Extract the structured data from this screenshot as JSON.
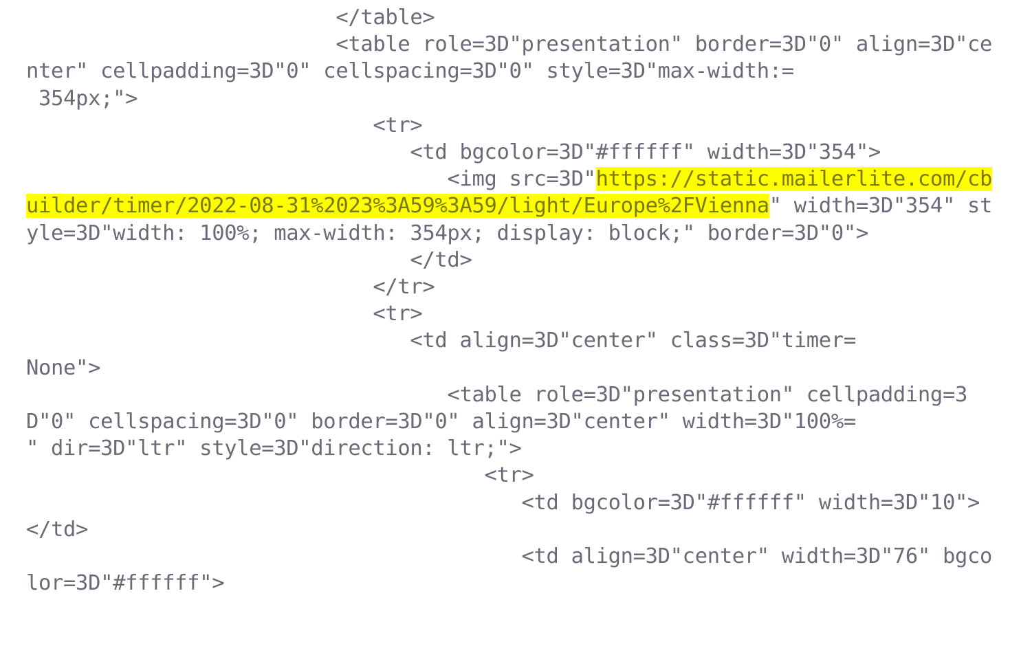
{
  "view": {
    "kind": "email-source-view",
    "background_color": "#ffffff",
    "text_color": "#6a6a78",
    "highlight_background_color": "#ffff00",
    "highlight_text_color": "#7a7a10"
  },
  "source": {
    "segment_1": "                         </table>\n                         <table role=3D\"presentation\" border=3D\"0\" align=3D\"center\" cellpadding=3D\"0\" cellspacing=3D\"0\" style=3D\"max-width:=\n 354px;\">\n                            <tr>\n                               <td bgcolor=3D\"#ffffff\" width=3D\"354\">\n                                  <img src=3D\"",
    "highlight_1": "https://static.mailerlite.com/cbuilder/timer/2022-08-31%2023%3A59%3A59/light/Europe%2FVienna",
    "segment_2": "\" width=3D\"354\" style=3D\"width: 100%; max-width: 354px; display: block;\" border=3D\"0\">\n                               </td>\n                            </tr>\n                            <tr>\n                               <td align=3D\"center\" class=3D\"timer=\nNone\">\n                                  <table role=3D\"presentation\" cellpadding=3D\"0\" cellspacing=3D\"0\" border=3D\"0\" align=3D\"center\" width=3D\"100%=\n\" dir=3D\"ltr\" style=3D\"direction: ltr;\">\n                                     <tr>\n                                        <td bgcolor=3D\"#ffffff\" width=3D\"10\"></td>\n                                        <td align=3D\"center\" width=3D\"76\" bgcolor=3D\"#ffffff\">"
  },
  "highlighted_match": {
    "protocol": "https",
    "host": "static.mailerlite.com",
    "path": "/cbuilder/timer/2022-08-31%2023%3A59%3A59/light/Europe%2FVienna",
    "decoded_datetime": "2022-08-31 23:59:59",
    "decoded_theme": "light",
    "decoded_timezone": "Europe/Vienna"
  }
}
